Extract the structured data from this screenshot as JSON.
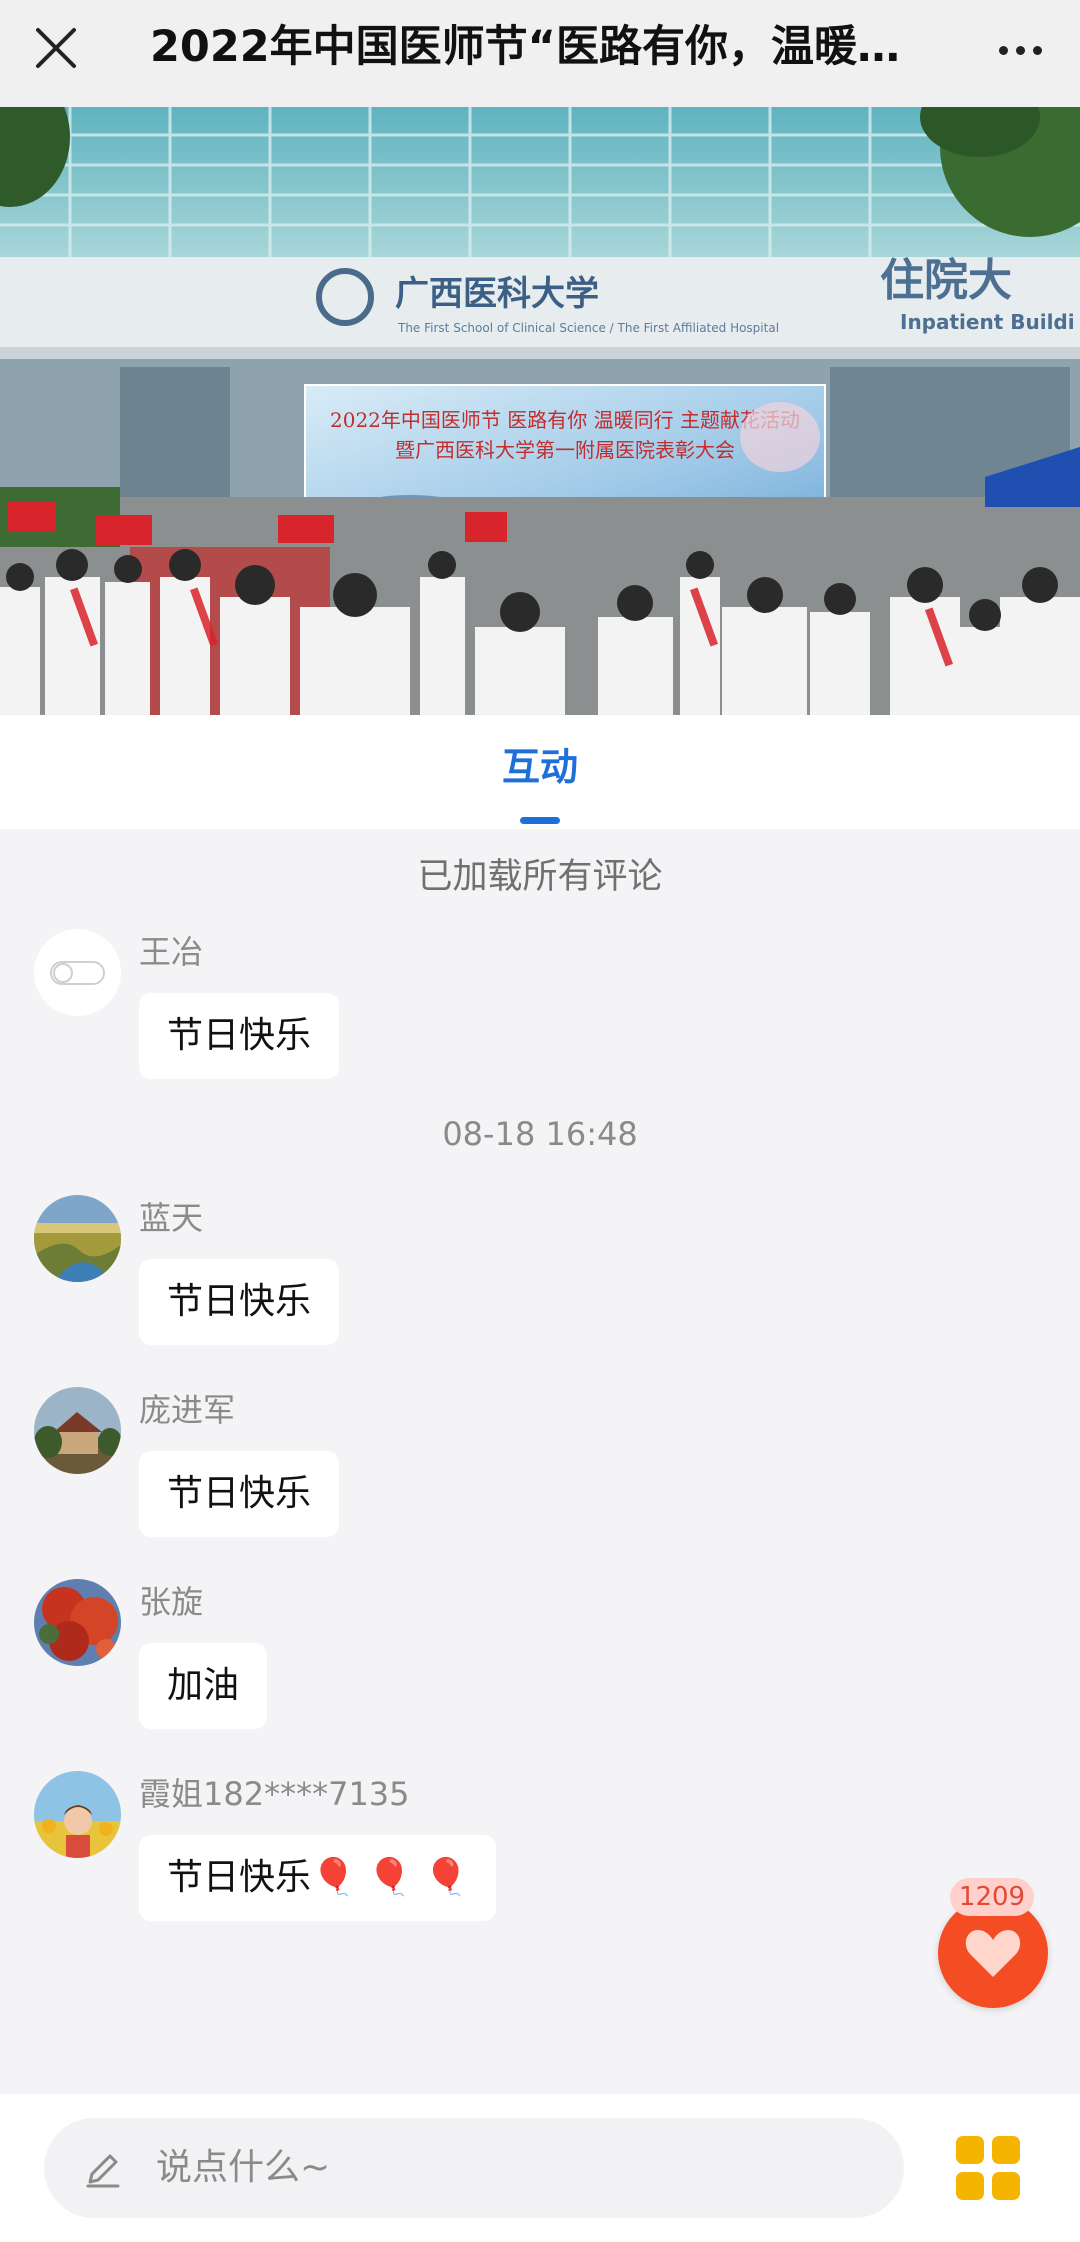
{
  "header": {
    "title": "2022年中国医师节“医路有你，温暖…",
    "close_icon": "close-icon",
    "more_icon": "more-horizontal-icon"
  },
  "video": {
    "banner_line1": "2022年中国医师节 医路有你 温暖同行 主题献花活动",
    "banner_line2": "暨广西医科大学第一附属医院表彰大会",
    "building_sign_cn": "广西医科大学",
    "building_sign_en": "The First School of Clinical Science / The First Affiliated Hospital",
    "hall_sign_cn": "住院大",
    "hall_sign_en": "Inpatient Buildi"
  },
  "tabs": {
    "active_label": "互动"
  },
  "comments": {
    "loaded_note": "已加载所有评论",
    "timestamp": "08-18 16:48",
    "items": [
      {
        "name": "王冶",
        "text": "节日快乐",
        "avatar": "toggle-avatar"
      },
      {
        "name": "蓝天",
        "text": "节日快乐",
        "avatar": "landscape-avatar"
      },
      {
        "name": "庞进军",
        "text": "节日快乐",
        "avatar": "house-avatar"
      },
      {
        "name": "张旋",
        "text": "加油",
        "avatar": "red-flowers-avatar"
      },
      {
        "name": "霞姐182****7135",
        "text": "节日快乐🎈 🎈 🎈",
        "avatar": "sunflower-avatar"
      }
    ]
  },
  "like": {
    "count": "1209",
    "icon": "heart-icon",
    "color": "#f44c23"
  },
  "bottom": {
    "placeholder": "说点什么~",
    "pencil_icon": "pencil-icon",
    "grid_icon": "apps-grid-icon"
  },
  "colors": {
    "accent": "#1e6fd9",
    "like": "#f44c23",
    "grid": "#f5b400"
  }
}
